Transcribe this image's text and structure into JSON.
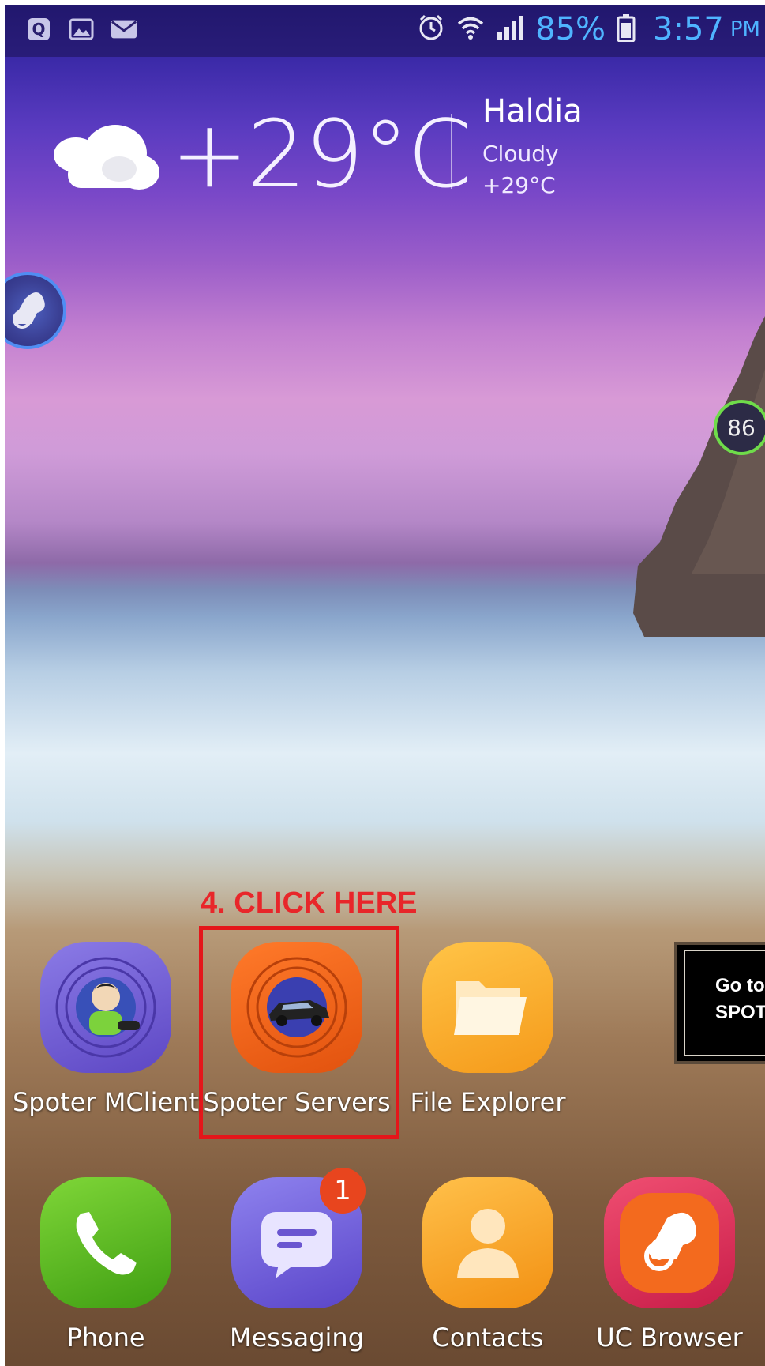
{
  "status_bar": {
    "left_icons": [
      "q-app-icon",
      "gallery-icon",
      "mail-icon"
    ],
    "right_icons": [
      "alarm-icon",
      "wifi-icon",
      "signal-icon",
      "battery-icon"
    ],
    "battery": "85%",
    "time": "3:57",
    "ampm": "PM",
    "accent": "#4fb4ff"
  },
  "weather": {
    "temperature": "+29°C",
    "city": "Haldia",
    "condition": "Cloudy",
    "small_temperature": "+29°C"
  },
  "floating": {
    "memory_percent": "86"
  },
  "annotation": {
    "title": "4.  CLICK HERE",
    "color": "#e4161a"
  },
  "tooltip": {
    "line1": "Go to",
    "line2": "SPOTE"
  },
  "apps_row1": [
    {
      "label": "Spoter MClient"
    },
    {
      "label": "Spoter Servers"
    },
    {
      "label": "File Explorer"
    }
  ],
  "dock": [
    {
      "label": "Phone"
    },
    {
      "label": "Messaging",
      "badge": "1"
    },
    {
      "label": "Contacts"
    },
    {
      "label": "UC Browser"
    }
  ]
}
